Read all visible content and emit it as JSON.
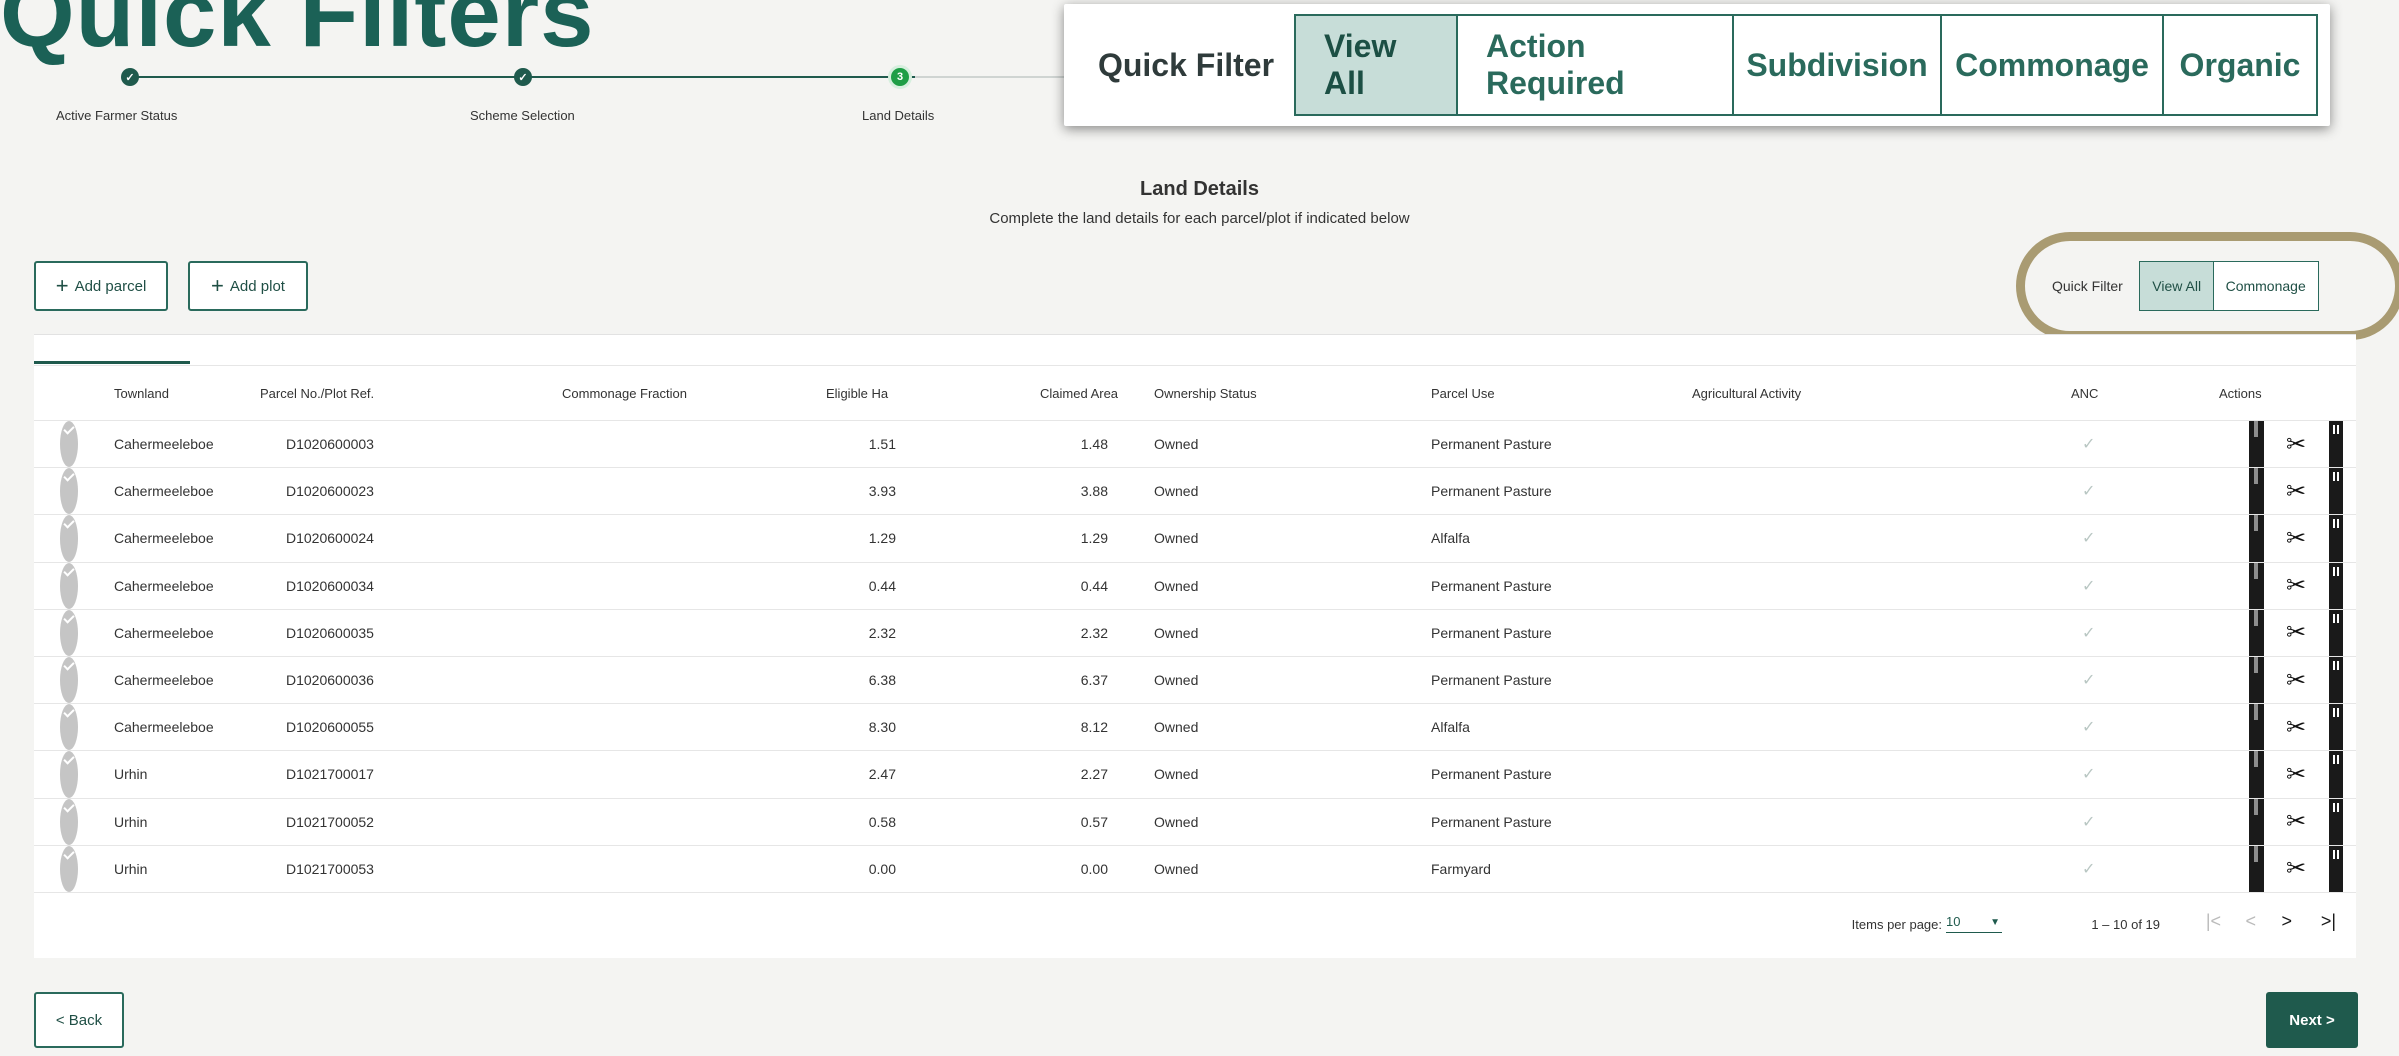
{
  "slide_title": "Quick Filters",
  "stepper": {
    "steps": [
      {
        "label": "Active Farmer Status",
        "state": "done",
        "marker": "✓"
      },
      {
        "label": "Scheme Selection",
        "state": "done",
        "marker": "✓"
      },
      {
        "label": "Land Details",
        "state": "current",
        "marker": "3"
      }
    ]
  },
  "zoom_quick_filter": {
    "label": "Quick Filter",
    "options": [
      "View All",
      "Action Required",
      "Subdivision",
      "Commonage",
      "Organic"
    ],
    "active": "View All"
  },
  "section": {
    "title": "Land Details",
    "subtitle": "Complete the land details for each parcel/plot if indicated below"
  },
  "toolbar": {
    "add_parcel": "Add parcel",
    "add_plot": "Add plot"
  },
  "quick_filter": {
    "label": "Quick Filter",
    "options": [
      "View All",
      "Commonage"
    ],
    "active": "View All"
  },
  "table": {
    "columns": [
      "Townland",
      "Parcel No./Plot Ref.",
      "Commonage Fraction",
      "Eligible Ha",
      "Claimed Area",
      "Ownership Status",
      "Parcel Use",
      "Agricultural Activity",
      "ANC",
      "Actions"
    ],
    "rows": [
      {
        "townland": "Cahermeeleboe",
        "parcel": "D1020600003",
        "fraction": "",
        "eligible": "1.51",
        "claimed": "1.48",
        "ownership": "Owned",
        "use": "Permanent Pasture",
        "activity": ""
      },
      {
        "townland": "Cahermeeleboe",
        "parcel": "D1020600023",
        "fraction": "",
        "eligible": "3.93",
        "claimed": "3.88",
        "ownership": "Owned",
        "use": "Permanent Pasture",
        "activity": ""
      },
      {
        "townland": "Cahermeeleboe",
        "parcel": "D1020600024",
        "fraction": "",
        "eligible": "1.29",
        "claimed": "1.29",
        "ownership": "Owned",
        "use": "Alfalfa",
        "activity": ""
      },
      {
        "townland": "Cahermeeleboe",
        "parcel": "D1020600034",
        "fraction": "",
        "eligible": "0.44",
        "claimed": "0.44",
        "ownership": "Owned",
        "use": "Permanent Pasture",
        "activity": ""
      },
      {
        "townland": "Cahermeeleboe",
        "parcel": "D1020600035",
        "fraction": "",
        "eligible": "2.32",
        "claimed": "2.32",
        "ownership": "Owned",
        "use": "Permanent Pasture",
        "activity": ""
      },
      {
        "townland": "Cahermeeleboe",
        "parcel": "D1020600036",
        "fraction": "",
        "eligible": "6.38",
        "claimed": "6.37",
        "ownership": "Owned",
        "use": "Permanent Pasture",
        "activity": ""
      },
      {
        "townland": "Cahermeeleboe",
        "parcel": "D1020600055",
        "fraction": "",
        "eligible": "8.30",
        "claimed": "8.12",
        "ownership": "Owned",
        "use": "Alfalfa",
        "activity": ""
      },
      {
        "townland": "Urhin",
        "parcel": "D1021700017",
        "fraction": "",
        "eligible": "2.47",
        "claimed": "2.27",
        "ownership": "Owned",
        "use": "Permanent Pasture",
        "activity": ""
      },
      {
        "townland": "Urhin",
        "parcel": "D1021700052",
        "fraction": "",
        "eligible": "0.58",
        "claimed": "0.57",
        "ownership": "Owned",
        "use": "Permanent Pasture",
        "activity": ""
      },
      {
        "townland": "Urhin",
        "parcel": "D1021700053",
        "fraction": "",
        "eligible": "0.00",
        "claimed": "0.00",
        "ownership": "Owned",
        "use": "Farmyard",
        "activity": ""
      }
    ],
    "anc_mark": "✓",
    "action_icons": [
      "map-icon",
      "scissors-icon",
      "trash-icon"
    ]
  },
  "pagination": {
    "items_per_page_label": "Items per page:",
    "items_per_page": "10",
    "range": "1 – 10 of 19",
    "first": "|<",
    "prev": "<",
    "next": ">",
    "last": ">|"
  },
  "footer": {
    "back": "< Back",
    "next": "Next >"
  },
  "colors": {
    "brand_green": "#1f5a4d",
    "title_green": "#1b6156",
    "active_filter_bg": "#c7ddd8",
    "highlight_ring": "#a99b72",
    "current_step": "#1e9e46"
  }
}
